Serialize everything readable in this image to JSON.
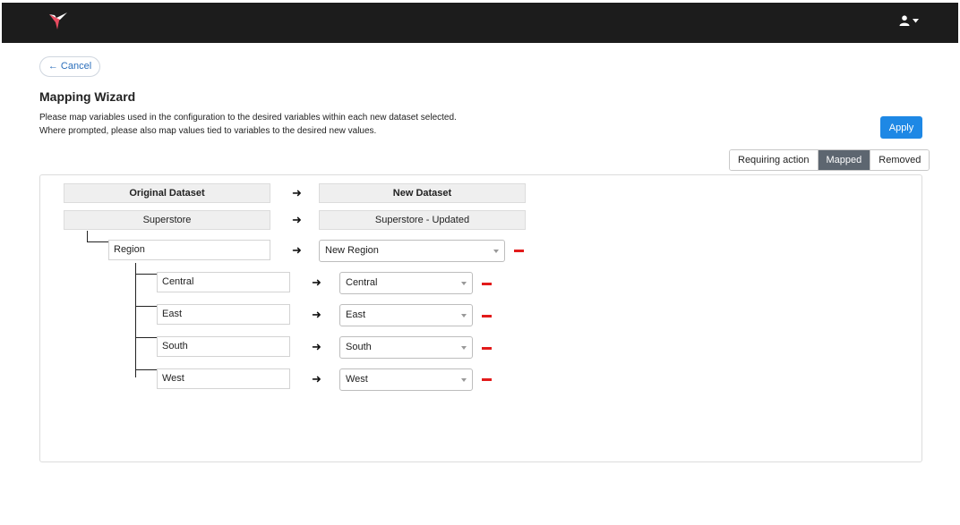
{
  "topbar": {
    "logo_icon": "hummingbird-logo-icon",
    "user_icon": "user-icon",
    "caret_icon": "caret-down-icon"
  },
  "cancel": {
    "label": "← Cancel"
  },
  "title": "Mapping Wizard",
  "description": {
    "line1": "Please map variables used in the configuration to the desired variables within each new dataset selected.",
    "line2": "Where prompted, please also map values tied to variables to the desired new values."
  },
  "apply": {
    "label": "Apply",
    "color": "#1e88e5"
  },
  "filters": {
    "requiring": "Requiring action",
    "mapped": "Mapped",
    "removed": "Removed",
    "active": "Mapped"
  },
  "mapping": {
    "header_original": "Original Dataset",
    "header_new": "New Dataset",
    "dataset_original": "Superstore",
    "dataset_new": "Superstore - Updated",
    "variable": {
      "original": "Region",
      "new": "New Region"
    },
    "values": [
      {
        "original": "Central",
        "new": "Central"
      },
      {
        "original": "East",
        "new": "East"
      },
      {
        "original": "South",
        "new": "South"
      },
      {
        "original": "West",
        "new": "West"
      }
    ],
    "arrow_icon": "arrow-right-icon",
    "remove_icon": "remove-minus-icon",
    "remove_color": "#e21b1b"
  }
}
